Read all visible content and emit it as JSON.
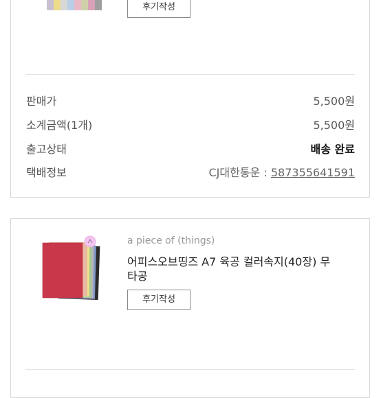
{
  "order1": {
    "review_button": "후기작성",
    "summary": {
      "price_label": "판매가",
      "price_value": "5,500원",
      "subtotal_label": "소계금액(1개)",
      "subtotal_value": "5,500원",
      "status_label": "출고상태",
      "status_value": "배송 완료",
      "delivery_label": "택배정보",
      "courier": "CJ대한통운 : ",
      "tracking_number": "587355641591"
    }
  },
  "order2": {
    "brand": "a piece of (things)",
    "product_name": "어피스오브띵즈 A7 육공 컬러속지(40장) 무타공",
    "review_button": "후기작성"
  },
  "colors": {
    "border": "#d9d9d9",
    "text_muted": "#555555",
    "brand_gray": "#9a9a9a",
    "sheet_red": "#c8384a",
    "sticker_pink": "#f3c6f0"
  }
}
